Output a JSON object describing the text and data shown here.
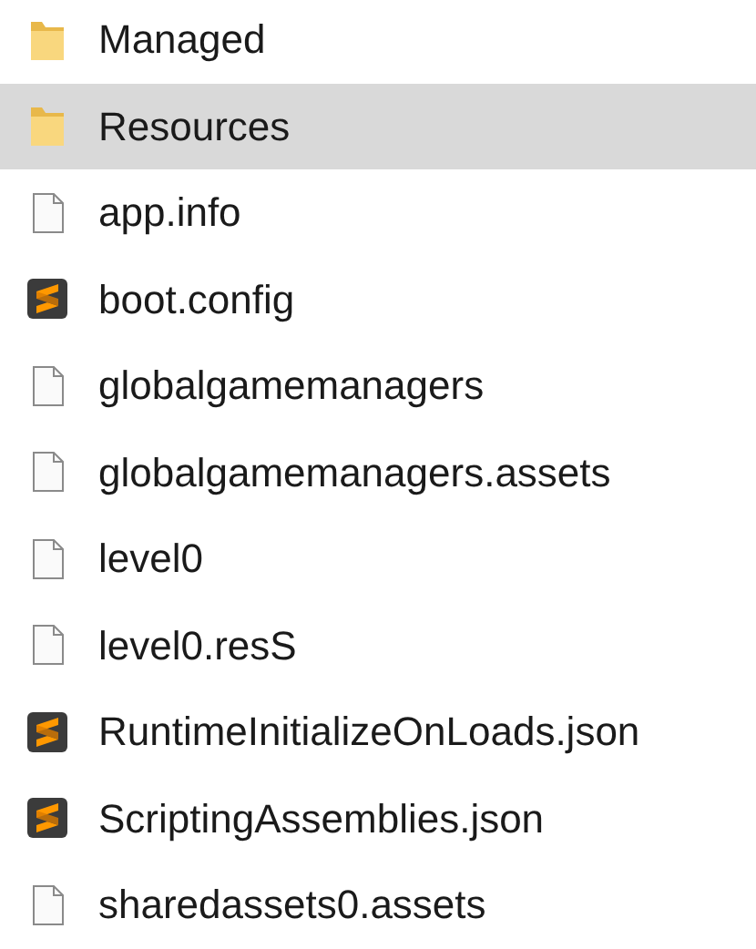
{
  "files": [
    {
      "name": "Managed",
      "kind": "folder",
      "selected": false
    },
    {
      "name": "Resources",
      "kind": "folder",
      "selected": true
    },
    {
      "name": "app.info",
      "kind": "file",
      "selected": false
    },
    {
      "name": "boot.config",
      "kind": "editor",
      "selected": false
    },
    {
      "name": "globalgamemanagers",
      "kind": "file",
      "selected": false
    },
    {
      "name": "globalgamemanagers.assets",
      "kind": "file",
      "selected": false
    },
    {
      "name": "level0",
      "kind": "file",
      "selected": false
    },
    {
      "name": "level0.resS",
      "kind": "file",
      "selected": false
    },
    {
      "name": "RuntimeInitializeOnLoads.json",
      "kind": "editor",
      "selected": false
    },
    {
      "name": "ScriptingAssemblies.json",
      "kind": "editor",
      "selected": false
    },
    {
      "name": "sharedassets0.assets",
      "kind": "file",
      "selected": false
    }
  ]
}
